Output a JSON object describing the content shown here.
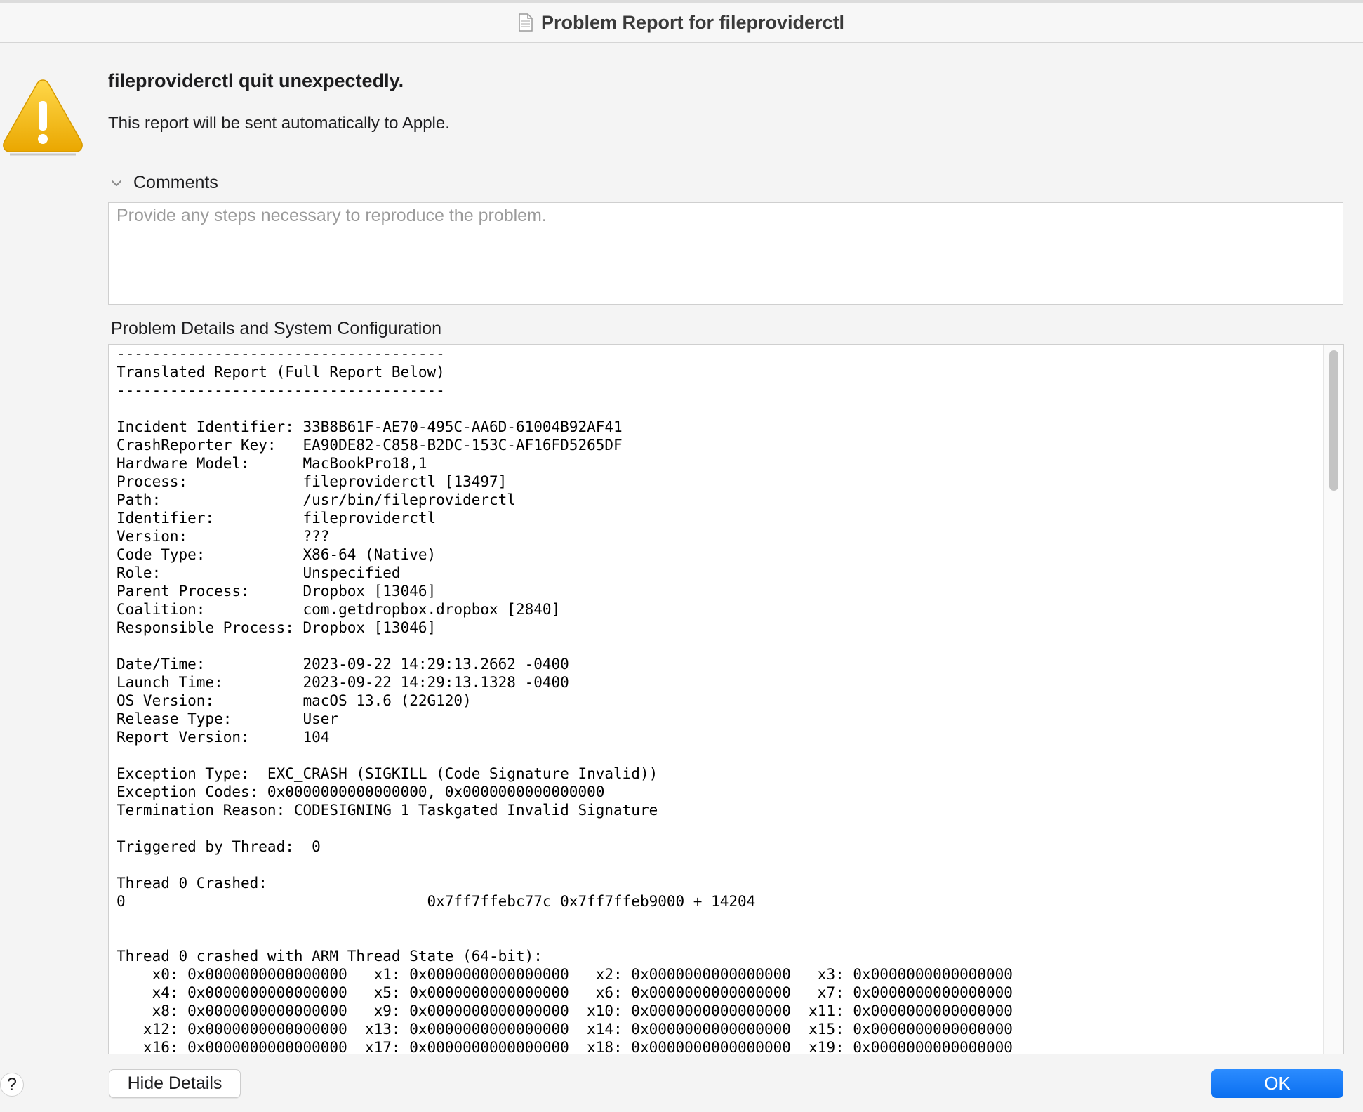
{
  "window": {
    "title": "Problem Report for fileproviderctl"
  },
  "alert": {
    "headline": "fileproviderctl quit unexpectedly.",
    "message": "This report will be sent automatically to Apple.",
    "icon": "warning-icon",
    "icon_color": "#f2b705"
  },
  "comments": {
    "label": "Comments",
    "placeholder": "Provide any steps necessary to reproduce the problem.",
    "value": ""
  },
  "details": {
    "label": "Problem Details and System Configuration",
    "report": "-------------------------------------\nTranslated Report (Full Report Below)\n-------------------------------------\n\nIncident Identifier: 33B8B61F-AE70-495C-AA6D-61004B92AF41\nCrashReporter Key:   EA90DE82-C858-B2DC-153C-AF16FD5265DF\nHardware Model:      MacBookPro18,1\nProcess:             fileproviderctl [13497]\nPath:                /usr/bin/fileproviderctl\nIdentifier:          fileproviderctl\nVersion:             ???\nCode Type:           X86-64 (Native)\nRole:                Unspecified\nParent Process:      Dropbox [13046]\nCoalition:           com.getdropbox.dropbox [2840]\nResponsible Process: Dropbox [13046]\n\nDate/Time:           2023-09-22 14:29:13.2662 -0400\nLaunch Time:         2023-09-22 14:29:13.1328 -0400\nOS Version:          macOS 13.6 (22G120)\nRelease Type:        User\nReport Version:      104\n\nException Type:  EXC_CRASH (SIGKILL (Code Signature Invalid))\nException Codes: 0x0000000000000000, 0x0000000000000000\nTermination Reason: CODESIGNING 1 Taskgated Invalid Signature\n\nTriggered by Thread:  0\n\nThread 0 Crashed:\n0                                  0x7ff7ffebc77c 0x7ff7ffeb9000 + 14204\n\n\nThread 0 crashed with ARM Thread State (64-bit):\n    x0: 0x0000000000000000   x1: 0x0000000000000000   x2: 0x0000000000000000   x3: 0x0000000000000000\n    x4: 0x0000000000000000   x5: 0x0000000000000000   x6: 0x0000000000000000   x7: 0x0000000000000000\n    x8: 0x0000000000000000   x9: 0x0000000000000000  x10: 0x0000000000000000  x11: 0x0000000000000000\n   x12: 0x0000000000000000  x13: 0x0000000000000000  x14: 0x0000000000000000  x15: 0x0000000000000000\n   x16: 0x0000000000000000  x17: 0x0000000000000000  x18: 0x0000000000000000  x19: 0x0000000000000000"
  },
  "footer": {
    "help_label": "?",
    "hide_details_label": "Hide Details",
    "ok_label": "OK",
    "ok_color": "#0a6ff0"
  }
}
